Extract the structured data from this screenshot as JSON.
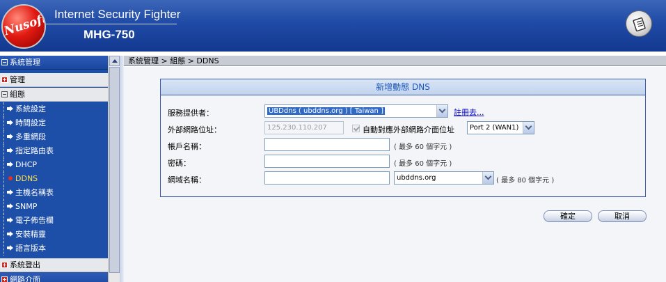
{
  "header": {
    "logo_text": "Nusoft",
    "title": "Internet Security Fighter",
    "model": "MHG-750",
    "note_icon": "notepad-icon"
  },
  "sidebar": {
    "top": "系統管理",
    "groups": [
      {
        "label": "管理",
        "state": "collapsed"
      },
      {
        "label": "組態",
        "state": "expanded"
      }
    ],
    "items": [
      {
        "label": "系統設定"
      },
      {
        "label": "時間設定"
      },
      {
        "label": "多重網段"
      },
      {
        "label": "指定路由表"
      },
      {
        "label": "DHCP"
      },
      {
        "label": "DDNS",
        "active": true
      },
      {
        "label": "主機名稱表"
      },
      {
        "label": "SNMP"
      },
      {
        "label": "電子佈告欄"
      },
      {
        "label": "安裝精靈"
      },
      {
        "label": "語言版本"
      }
    ],
    "bottom_groups": [
      {
        "label": "系統登出"
      },
      {
        "label": "網路介面"
      }
    ],
    "active_color": "#ffe14d"
  },
  "breadcrumb": "系統管理 > 組態 > DDNS",
  "panel": {
    "title": "新增動態 DNS",
    "provider": {
      "label": "服務提供者：",
      "value": "UBDdns ( ubddns.org ) [ Taiwan ]",
      "link": "註冊去..."
    },
    "external_ip": {
      "label": "外部網路位址：",
      "value": "125.230.110.207",
      "auto_label": "自動對應外部網路介面位址",
      "port_value": "Port 2 (WAN1)"
    },
    "account": {
      "label": "帳戶名稱：",
      "value": "",
      "hint": "( 最多 60 個字元 )"
    },
    "password": {
      "label": "密碼：",
      "value": "",
      "hint": "( 最多 60 個字元 )"
    },
    "domain": {
      "label": "網域名稱：",
      "value": "",
      "suffix_value": "ubddns.org",
      "hint": "( 最多 80 個字元 )"
    }
  },
  "buttons": {
    "ok": "確定",
    "cancel": "取消"
  }
}
